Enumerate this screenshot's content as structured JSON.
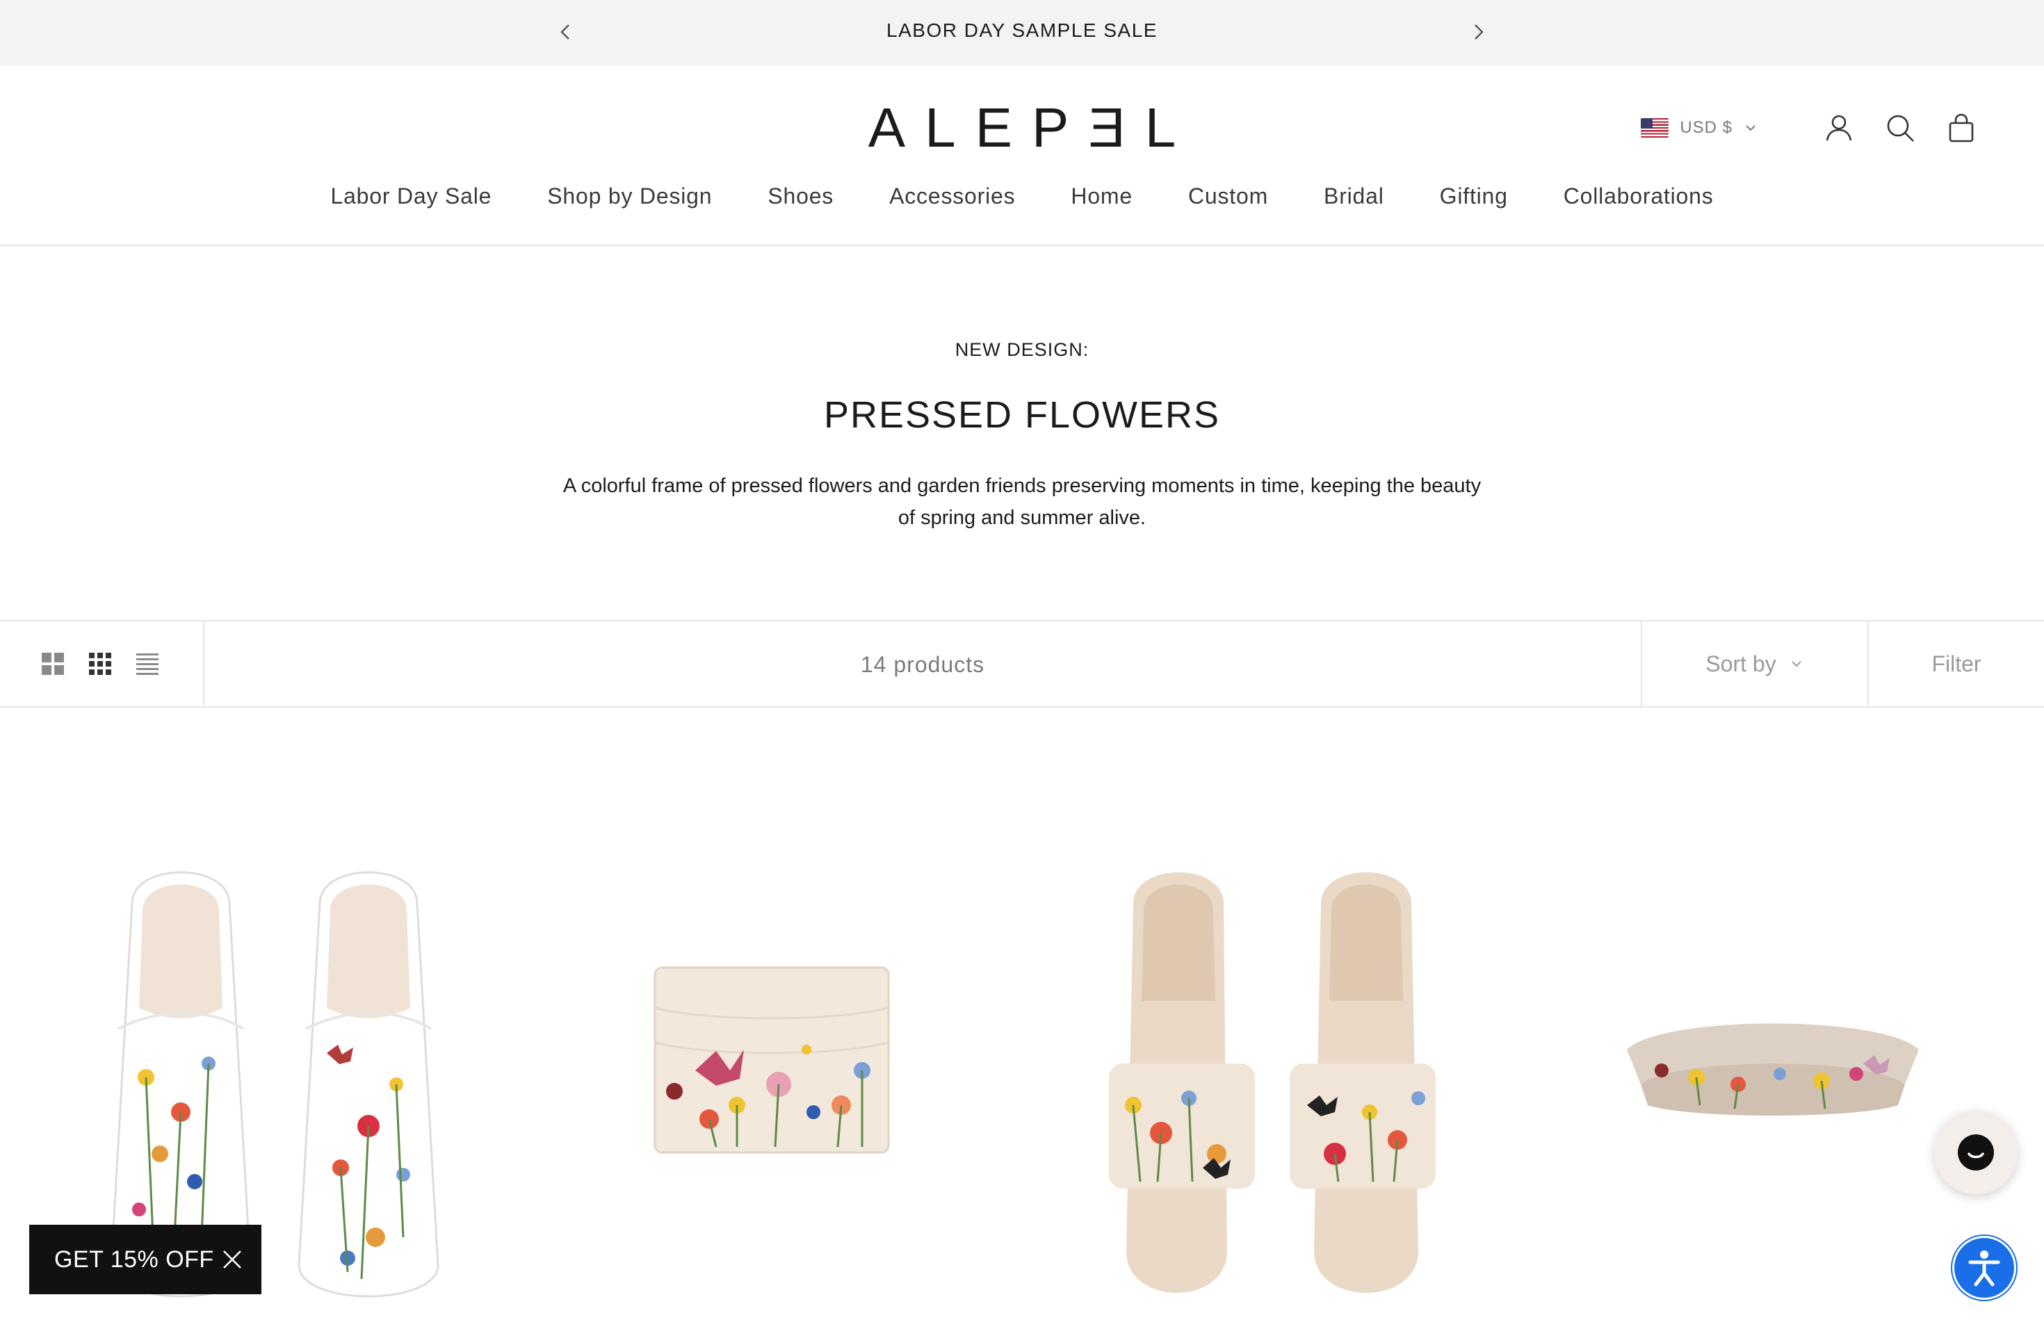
{
  "announcement": {
    "text": "LABOR DAY SAMPLE SALE",
    "prev_icon": "chevron-left-icon",
    "next_icon": "chevron-right-icon"
  },
  "header": {
    "logo": "ALEPƎL",
    "currency": "USD $",
    "currency_flag": "us-flag-icon",
    "icons": [
      "account-icon",
      "search-icon",
      "cart-icon"
    ]
  },
  "nav": {
    "items": [
      {
        "label": "Labor Day Sale"
      },
      {
        "label": "Shop by Design"
      },
      {
        "label": "Shoes"
      },
      {
        "label": "Accessories"
      },
      {
        "label": "Home"
      },
      {
        "label": "Custom"
      },
      {
        "label": "Bridal"
      },
      {
        "label": "Gifting"
      },
      {
        "label": "Collaborations"
      }
    ]
  },
  "collection": {
    "eyebrow": "NEW DESIGN:",
    "title": "PRESSED FLOWERS",
    "description": "A colorful frame of pressed flowers and garden friends preserving moments in time, keeping the beauty of spring and summer alive."
  },
  "toolbar": {
    "product_count": "14 products",
    "sort_label": "Sort by",
    "filter_label": "Filter",
    "layout_icons": [
      "grid-large-icon",
      "grid-small-icon",
      "list-icon"
    ]
  },
  "products": [
    {
      "kind": "mules",
      "image": "floral-mules-image"
    },
    {
      "kind": "card-holder",
      "image": "floral-card-holder-image"
    },
    {
      "kind": "slides",
      "image": "floral-slides-image"
    },
    {
      "kind": "headband",
      "image": "floral-headband-image"
    }
  ],
  "popup": {
    "discount_label": "GET 15% OFF"
  },
  "colors": {
    "announcement_bg": "#f3f3f3",
    "accessibility_blue": "#1a6ee8",
    "popup_bg": "#111111",
    "text": "#1c1b1b"
  }
}
